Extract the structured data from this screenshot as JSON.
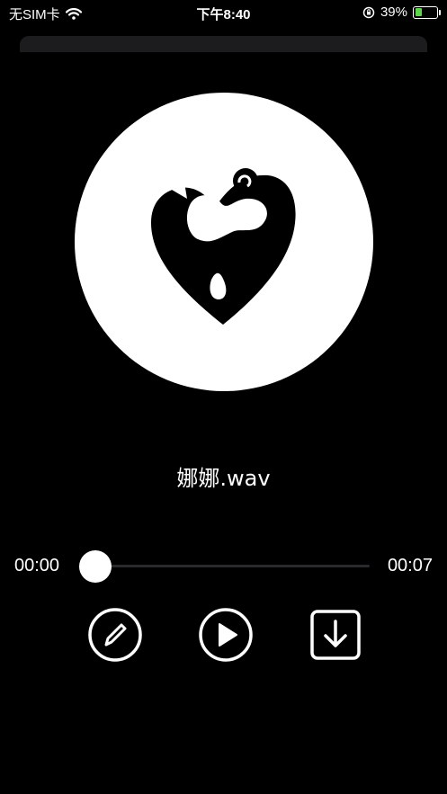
{
  "status_bar": {
    "carrier": "无SIM卡",
    "time": "下午8:40",
    "battery_percent": "39%",
    "battery_level": 0.39,
    "battery_color": "#5bd649"
  },
  "player": {
    "file_name": "娜娜.wav",
    "current_time": "00:00",
    "total_time": "00:07",
    "progress": 0.0
  },
  "controls": {
    "edit_icon": "pencil-icon",
    "play_icon": "play-icon",
    "download_icon": "download-icon"
  }
}
